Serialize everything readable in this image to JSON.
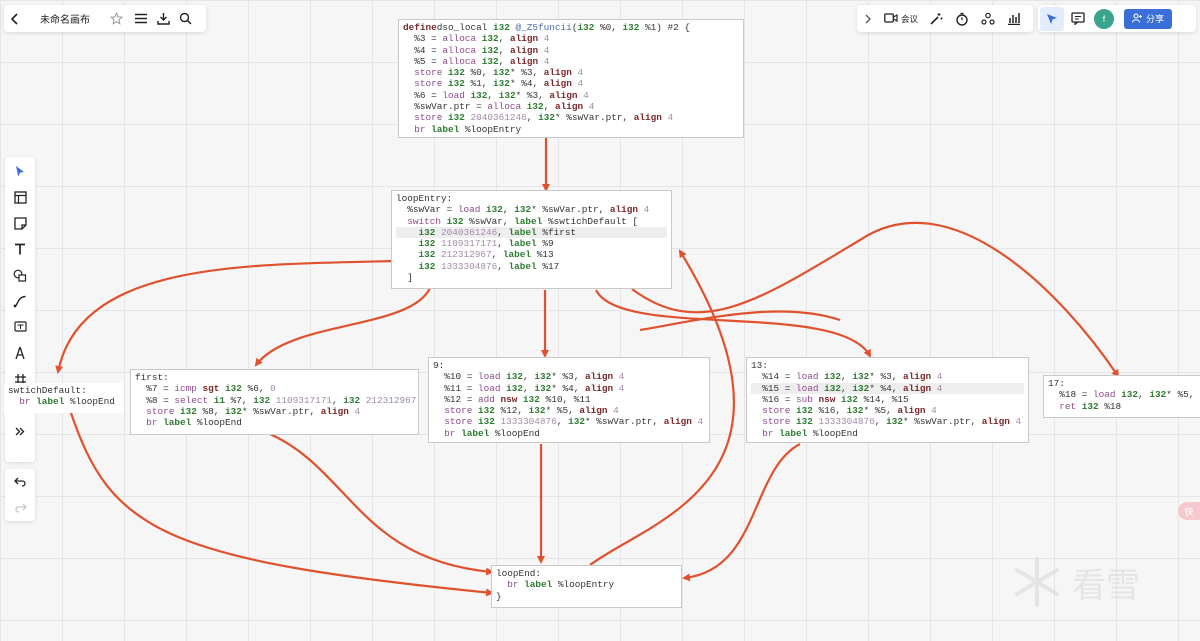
{
  "topbar_left": {
    "back_icon": "chevron-left-icon",
    "title": "未命名画布",
    "star_icon": "star-icon",
    "menu_icon": "menu-icon",
    "download_icon": "download-icon",
    "search_icon": "search-icon"
  },
  "topbar_right": {
    "expand_icon": "chevron-right-icon",
    "meeting_label": "会议",
    "share_label": "分享",
    "avatar_text": "f",
    "accent_color": "#3b6fd8",
    "avatar_color": "#3aa58c"
  },
  "tools": [
    "pointer-icon",
    "frame-icon",
    "sticky-note-icon",
    "text-icon",
    "shapes-icon",
    "connector-icon",
    "comment-icon",
    "pen-icon",
    "hash-frame-icon",
    "sticker-icon",
    "more-icon"
  ],
  "history": {
    "undo_icon": "undo-icon",
    "redo_icon": "redo-icon"
  },
  "edge_color": "#e0522e",
  "watermark": "看雪",
  "float_badge": "快",
  "nodes": {
    "entry": [
      [
        [
          "kw",
          "define"
        ],
        [
          "",
          "dso_local "
        ],
        [
          "ty",
          "i32"
        ],
        [
          "fn",
          " @_Z5funcii"
        ],
        [
          "",
          "("
        ],
        [
          "ty",
          "i32"
        ],
        [
          "",
          " %0, "
        ],
        [
          "ty",
          "i32"
        ],
        [
          "",
          " %1) #2 {"
        ]
      ],
      [
        [
          "",
          "  %3 = "
        ],
        [
          "op",
          "alloca"
        ],
        [
          "ty",
          " i32"
        ],
        [
          "",
          ", "
        ],
        [
          "kw",
          "align"
        ],
        [
          "num",
          " 4"
        ]
      ],
      [
        [
          "",
          "  %4 = "
        ],
        [
          "op",
          "alloca"
        ],
        [
          "ty",
          " i32"
        ],
        [
          "",
          ", "
        ],
        [
          "kw",
          "align"
        ],
        [
          "num",
          " 4"
        ]
      ],
      [
        [
          "",
          "  %5 = "
        ],
        [
          "op",
          "alloca"
        ],
        [
          "ty",
          " i32"
        ],
        [
          "",
          ", "
        ],
        [
          "kw",
          "align"
        ],
        [
          "num",
          " 4"
        ]
      ],
      [
        [
          "op",
          "  store"
        ],
        [
          "ty",
          " i32"
        ],
        [
          "",
          " %0, "
        ],
        [
          "ty",
          "i32"
        ],
        [
          "",
          "* %3, "
        ],
        [
          "kw",
          "align"
        ],
        [
          "num",
          " 4"
        ]
      ],
      [
        [
          "op",
          "  store"
        ],
        [
          "ty",
          " i32"
        ],
        [
          "",
          " %1, "
        ],
        [
          "ty",
          "i32"
        ],
        [
          "",
          "* %4, "
        ],
        [
          "kw",
          "align"
        ],
        [
          "num",
          " 4"
        ]
      ],
      [
        [
          "",
          "  %6 = "
        ],
        [
          "op",
          "load"
        ],
        [
          "ty",
          " i32"
        ],
        [
          "",
          ", "
        ],
        [
          "ty",
          "i32"
        ],
        [
          "",
          "* %3, "
        ],
        [
          "kw",
          "align"
        ],
        [
          "num",
          " 4"
        ]
      ],
      [
        [
          "",
          "  %swVar.ptr = "
        ],
        [
          "op",
          "alloca"
        ],
        [
          "ty",
          " i32"
        ],
        [
          "",
          ", "
        ],
        [
          "kw",
          "align"
        ],
        [
          "num",
          " 4"
        ]
      ],
      [
        [
          "op",
          "  store"
        ],
        [
          "ty",
          " i32"
        ],
        [
          "num",
          " 2040361246"
        ],
        [
          "",
          ", "
        ],
        [
          "ty",
          "i32"
        ],
        [
          "",
          "* %swVar.ptr, "
        ],
        [
          "kw",
          "align"
        ],
        [
          "num",
          " 4"
        ]
      ],
      [
        [
          "op",
          "  br"
        ],
        [
          "ty",
          " label"
        ],
        [
          "",
          " %loopEntry"
        ]
      ]
    ],
    "loopEntry": [
      [
        [
          "",
          "loopEntry:"
        ]
      ],
      [
        [
          "",
          "  %swVar = "
        ],
        [
          "op",
          "load"
        ],
        [
          "ty",
          " i32"
        ],
        [
          "",
          ", "
        ],
        [
          "ty",
          "i32"
        ],
        [
          "",
          "* %swVar.ptr, "
        ],
        [
          "kw",
          "align"
        ],
        [
          "num",
          " 4"
        ]
      ],
      [
        [
          "op",
          "  switch"
        ],
        [
          "ty",
          " i32"
        ],
        [
          "",
          " %swVar, "
        ],
        [
          "ty",
          "label"
        ],
        [
          "",
          " %swtichDefault ["
        ]
      ],
      [
        [
          "ty",
          "    i32"
        ],
        [
          "num",
          " 2040361246"
        ],
        [
          "",
          ", "
        ],
        [
          "ty",
          "label"
        ],
        [
          "",
          " %first"
        ]
      ],
      [
        [
          "ty",
          "    i32"
        ],
        [
          "num",
          " 1109317171"
        ],
        [
          "",
          ", "
        ],
        [
          "ty",
          "label"
        ],
        [
          "",
          " %9"
        ]
      ],
      [
        [
          "ty",
          "    i32"
        ],
        [
          "num",
          " 212312967"
        ],
        [
          "",
          ", "
        ],
        [
          "ty",
          "label"
        ],
        [
          "",
          " %13"
        ]
      ],
      [
        [
          "ty",
          "    i32"
        ],
        [
          "num",
          " 1333304876"
        ],
        [
          "",
          ", "
        ],
        [
          "ty",
          "label"
        ],
        [
          "",
          " %17"
        ]
      ],
      [
        [
          "",
          "  ]"
        ]
      ]
    ],
    "swtichDefault": [
      [
        [
          "",
          "swtichDefault:"
        ]
      ],
      [
        [
          "op",
          "  br"
        ],
        [
          "ty",
          " label"
        ],
        [
          "",
          " %loopEnd"
        ]
      ]
    ],
    "first": [
      [
        [
          "",
          "first:"
        ]
      ],
      [
        [
          "",
          "  %7 = "
        ],
        [
          "op",
          "icmp"
        ],
        [
          "kw",
          " sgt"
        ],
        [
          "ty",
          " i32"
        ],
        [
          "",
          " %6, "
        ],
        [
          "num",
          "0"
        ]
      ],
      [
        [
          "",
          "  %8 = "
        ],
        [
          "op",
          "select"
        ],
        [
          "ty",
          " i1"
        ],
        [
          "",
          " %7, "
        ],
        [
          "ty",
          "i32"
        ],
        [
          "num",
          " 1109317171"
        ],
        [
          "",
          ", "
        ],
        [
          "ty",
          "i32"
        ],
        [
          "num",
          " 212312967"
        ]
      ],
      [
        [
          "op",
          "  store"
        ],
        [
          "ty",
          " i32"
        ],
        [
          "",
          " %8, "
        ],
        [
          "ty",
          "i32"
        ],
        [
          "",
          "* %swVar.ptr, "
        ],
        [
          "kw",
          "align"
        ],
        [
          "num",
          " 4"
        ]
      ],
      [
        [
          "op",
          "  br"
        ],
        [
          "ty",
          " label"
        ],
        [
          "",
          " %loopEnd"
        ]
      ]
    ],
    "b9": [
      [
        [
          "",
          "9:"
        ]
      ],
      [
        [
          "",
          "  %10 = "
        ],
        [
          "op",
          "load"
        ],
        [
          "ty",
          " i32"
        ],
        [
          "",
          ", "
        ],
        [
          "ty",
          "i32"
        ],
        [
          "",
          "* %3, "
        ],
        [
          "kw",
          "align"
        ],
        [
          "num",
          " 4"
        ]
      ],
      [
        [
          "",
          "  %11 = "
        ],
        [
          "op",
          "load"
        ],
        [
          "ty",
          " i32"
        ],
        [
          "",
          ", "
        ],
        [
          "ty",
          "i32"
        ],
        [
          "",
          "* %4, "
        ],
        [
          "kw",
          "align"
        ],
        [
          "num",
          " 4"
        ]
      ],
      [
        [
          "",
          "  %12 = "
        ],
        [
          "op",
          "add"
        ],
        [
          "kw",
          " nsw"
        ],
        [
          "ty",
          " i32"
        ],
        [
          "",
          " %10, %11"
        ]
      ],
      [
        [
          "op",
          "  store"
        ],
        [
          "ty",
          " i32"
        ],
        [
          "",
          " %12, "
        ],
        [
          "ty",
          "i32"
        ],
        [
          "",
          "* %5, "
        ],
        [
          "kw",
          "align"
        ],
        [
          "num",
          " 4"
        ]
      ],
      [
        [
          "op",
          "  store"
        ],
        [
          "ty",
          " i32"
        ],
        [
          "num",
          " 1333304876"
        ],
        [
          "",
          ", "
        ],
        [
          "ty",
          "i32"
        ],
        [
          "",
          "* %swVar.ptr, "
        ],
        [
          "kw",
          "align"
        ],
        [
          "num",
          " 4"
        ]
      ],
      [
        [
          "op",
          "  br"
        ],
        [
          "ty",
          " label"
        ],
        [
          "",
          " %loopEnd"
        ]
      ]
    ],
    "b13": [
      [
        [
          "",
          "13:"
        ]
      ],
      [
        [
          "",
          "  %14 = "
        ],
        [
          "op",
          "load"
        ],
        [
          "ty",
          " i32"
        ],
        [
          "",
          ", "
        ],
        [
          "ty",
          "i32"
        ],
        [
          "",
          "* %3, "
        ],
        [
          "kw",
          "align"
        ],
        [
          "num",
          " 4"
        ]
      ],
      [
        [
          "",
          "  %15 = "
        ],
        [
          "op",
          "load"
        ],
        [
          "ty",
          " i32"
        ],
        [
          "",
          ", "
        ],
        [
          "ty",
          "i32"
        ],
        [
          "",
          "* %4, "
        ],
        [
          "kw",
          "align"
        ],
        [
          "num",
          " 4"
        ]
      ],
      [
        [
          "",
          "  %16 = "
        ],
        [
          "op",
          "sub"
        ],
        [
          "kw",
          " nsw"
        ],
        [
          "ty",
          " i32"
        ],
        [
          "",
          " %14, %15"
        ]
      ],
      [
        [
          "op",
          "  store"
        ],
        [
          "ty",
          " i32"
        ],
        [
          "",
          " %16, "
        ],
        [
          "ty",
          "i32"
        ],
        [
          "",
          "* %5, "
        ],
        [
          "kw",
          "align"
        ],
        [
          "num",
          " 4"
        ]
      ],
      [
        [
          "op",
          "  store"
        ],
        [
          "ty",
          " i32"
        ],
        [
          "num",
          " 1333304876"
        ],
        [
          "",
          ", "
        ],
        [
          "ty",
          "i32"
        ],
        [
          "",
          "* %swVar.ptr, "
        ],
        [
          "kw",
          "align"
        ],
        [
          "num",
          " 4"
        ]
      ],
      [
        [
          "op",
          "  br"
        ],
        [
          "ty",
          " label"
        ],
        [
          "",
          " %loopEnd"
        ]
      ]
    ],
    "b17": [
      [
        [
          "",
          "17:"
        ]
      ],
      [
        [
          "",
          "  %18 = "
        ],
        [
          "op",
          "load"
        ],
        [
          "ty",
          " i32"
        ],
        [
          "",
          ", "
        ],
        [
          "ty",
          "i32"
        ],
        [
          "",
          "* %5,"
        ]
      ],
      [
        [
          "op",
          "  ret"
        ],
        [
          "ty",
          " i32"
        ],
        [
          "",
          " %18"
        ]
      ]
    ],
    "loopEnd": [
      [
        [
          "",
          "loopEnd:"
        ]
      ],
      [
        [
          "op",
          "  br"
        ],
        [
          "ty",
          " label"
        ],
        [
          "",
          " %loopEntry"
        ]
      ],
      [
        [
          "",
          "}"
        ]
      ]
    ]
  }
}
